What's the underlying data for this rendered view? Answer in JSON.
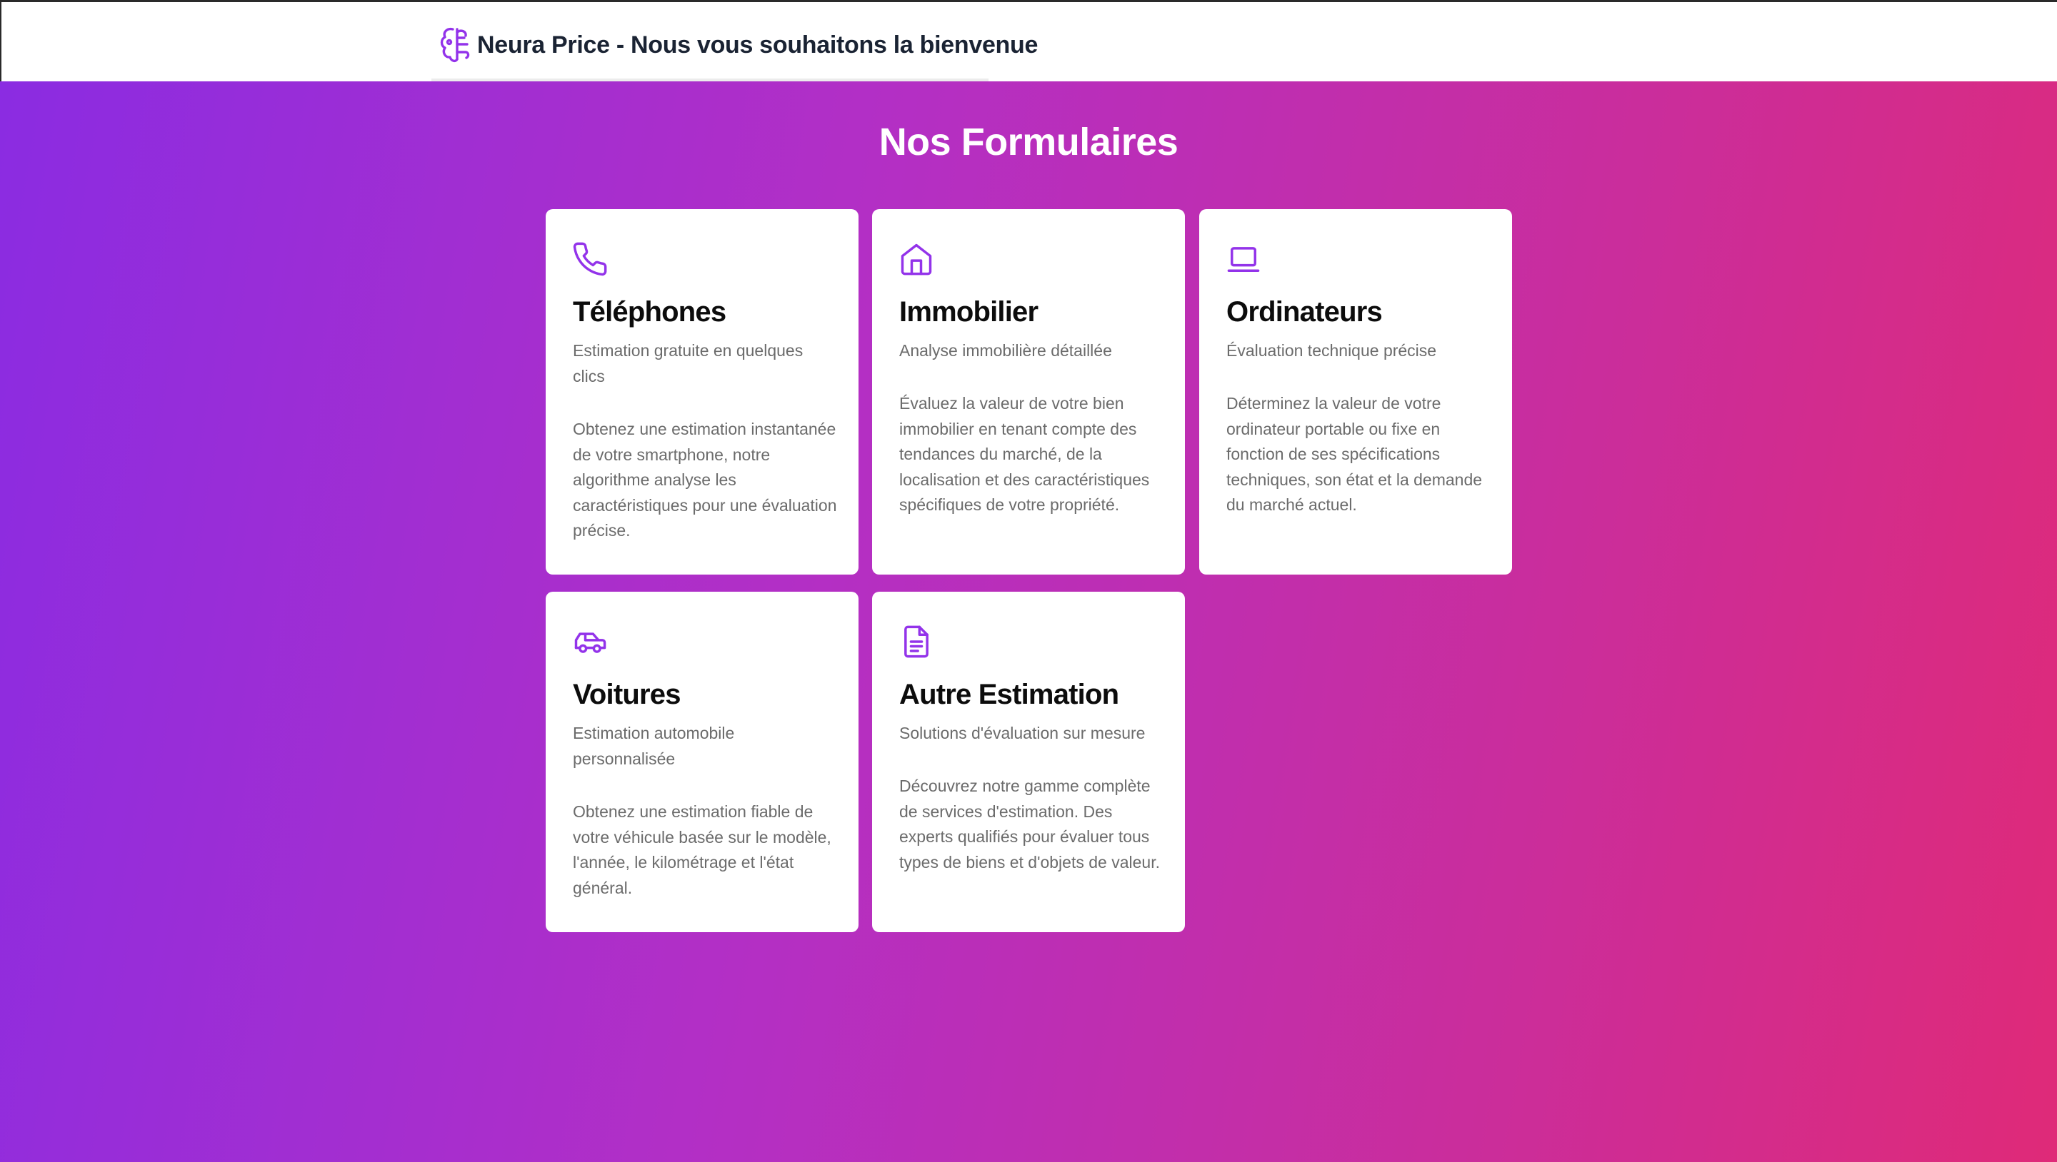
{
  "header": {
    "title": "Neura Price - Nous vous souhaitons la bienvenue",
    "logo_icon": "brain-icon",
    "accent_color": "#9333ea"
  },
  "main": {
    "title": "Nos Formulaires",
    "background_gradient": [
      "#8a2ce2",
      "#df2a78"
    ],
    "cards": [
      {
        "icon": "phone-icon",
        "title": "Téléphones",
        "subtitle": "Estimation gratuite en quelques clics",
        "description": "Obtenez une estimation instantanée de votre smartphone, notre algorithme analyse les caractéristiques pour une évaluation précise."
      },
      {
        "icon": "home-icon",
        "title": "Immobilier",
        "subtitle": "Analyse immobilière détaillée",
        "description": "Évaluez la valeur de votre bien immobilier en tenant compte des tendances du marché, de la localisation et des caractéristiques spécifiques de votre propriété."
      },
      {
        "icon": "laptop-icon",
        "title": "Ordinateurs",
        "subtitle": "Évaluation technique précise",
        "description": "Déterminez la valeur de votre ordinateur portable ou fixe en fonction de ses spécifications techniques, son état et la demande du marché actuel."
      },
      {
        "icon": "car-icon",
        "title": "Voitures",
        "subtitle": "Estimation automobile personnalisée",
        "description": "Obtenez une estimation fiable de votre véhicule basée sur le modèle, l'année, le kilométrage et l'état général."
      },
      {
        "icon": "document-icon",
        "title": "Autre Estimation",
        "subtitle": "Solutions d'évaluation sur mesure",
        "description": "Découvrez notre gamme complète de services d'estimation. Des experts qualifiés pour évaluer tous types de biens et d'objets de valeur."
      }
    ]
  }
}
